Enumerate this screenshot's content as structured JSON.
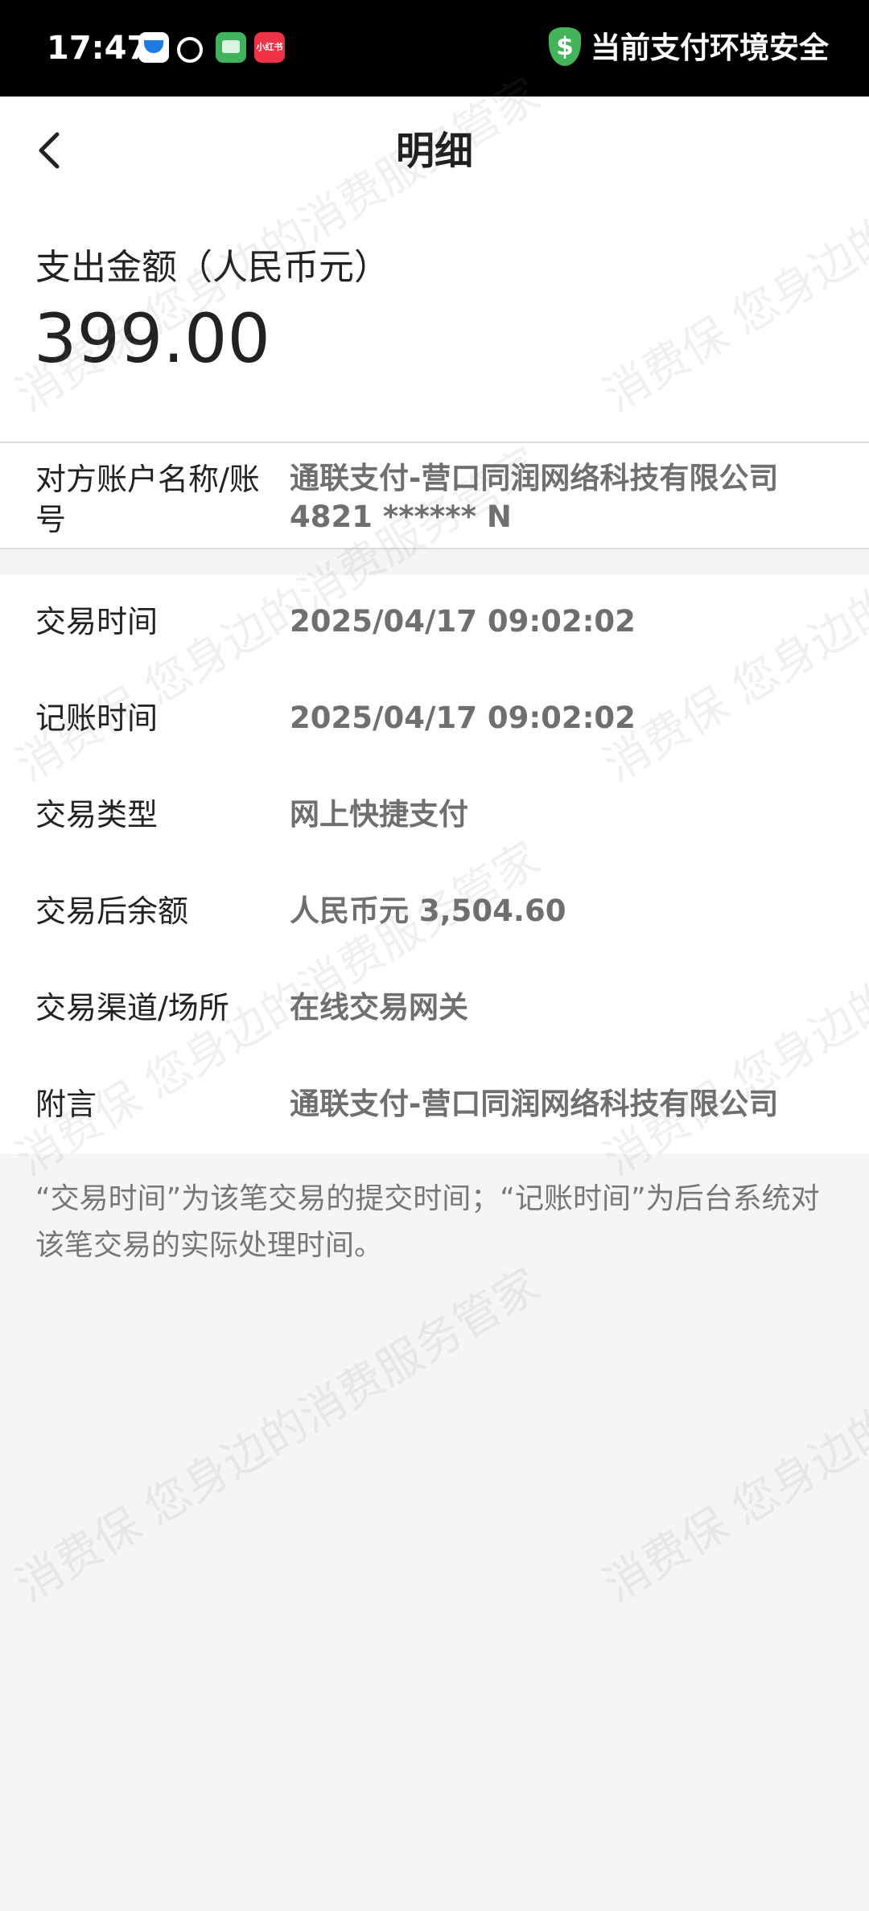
{
  "status_bar": {
    "time": "17:47",
    "app_icons": [
      "tencent-app-icon",
      "chat-bubble-icon",
      "message-app-icon",
      "xiaohongshu-icon"
    ],
    "xiaohongshu_label": "小红书",
    "security_icon": "dollar-shield-icon",
    "security_text": "当前支付环境安全",
    "security_color": "#43B45A"
  },
  "header": {
    "back_icon": "chevron-left-icon",
    "title": "明细"
  },
  "summary": {
    "amount_label": "支出金额（人民币元）",
    "amount_value": "399.00"
  },
  "account": {
    "label": "对方账户名称/账号",
    "name": "通联支付-营口同润网络科技有限公司",
    "number": "4821 ******    N"
  },
  "details": [
    {
      "label": "交易时间",
      "value": "2025/04/17  09:02:02"
    },
    {
      "label": "记账时间",
      "value": "2025/04/17  09:02:02"
    },
    {
      "label": "交易类型",
      "value": "网上快捷支付"
    },
    {
      "label": "交易后余额",
      "value": "人民币元 3,504.60"
    },
    {
      "label": "交易渠道/场所",
      "value": "在线交易网关"
    },
    {
      "label": "附言",
      "value": "通联支付-营口同润网络科技有限公司"
    }
  ],
  "note": "“交易时间”为该笔交易的提交时间；“记账时间”为后台系统对该笔交易的实际处理时间。",
  "watermark": "消费保 您身边的消费服务管家"
}
